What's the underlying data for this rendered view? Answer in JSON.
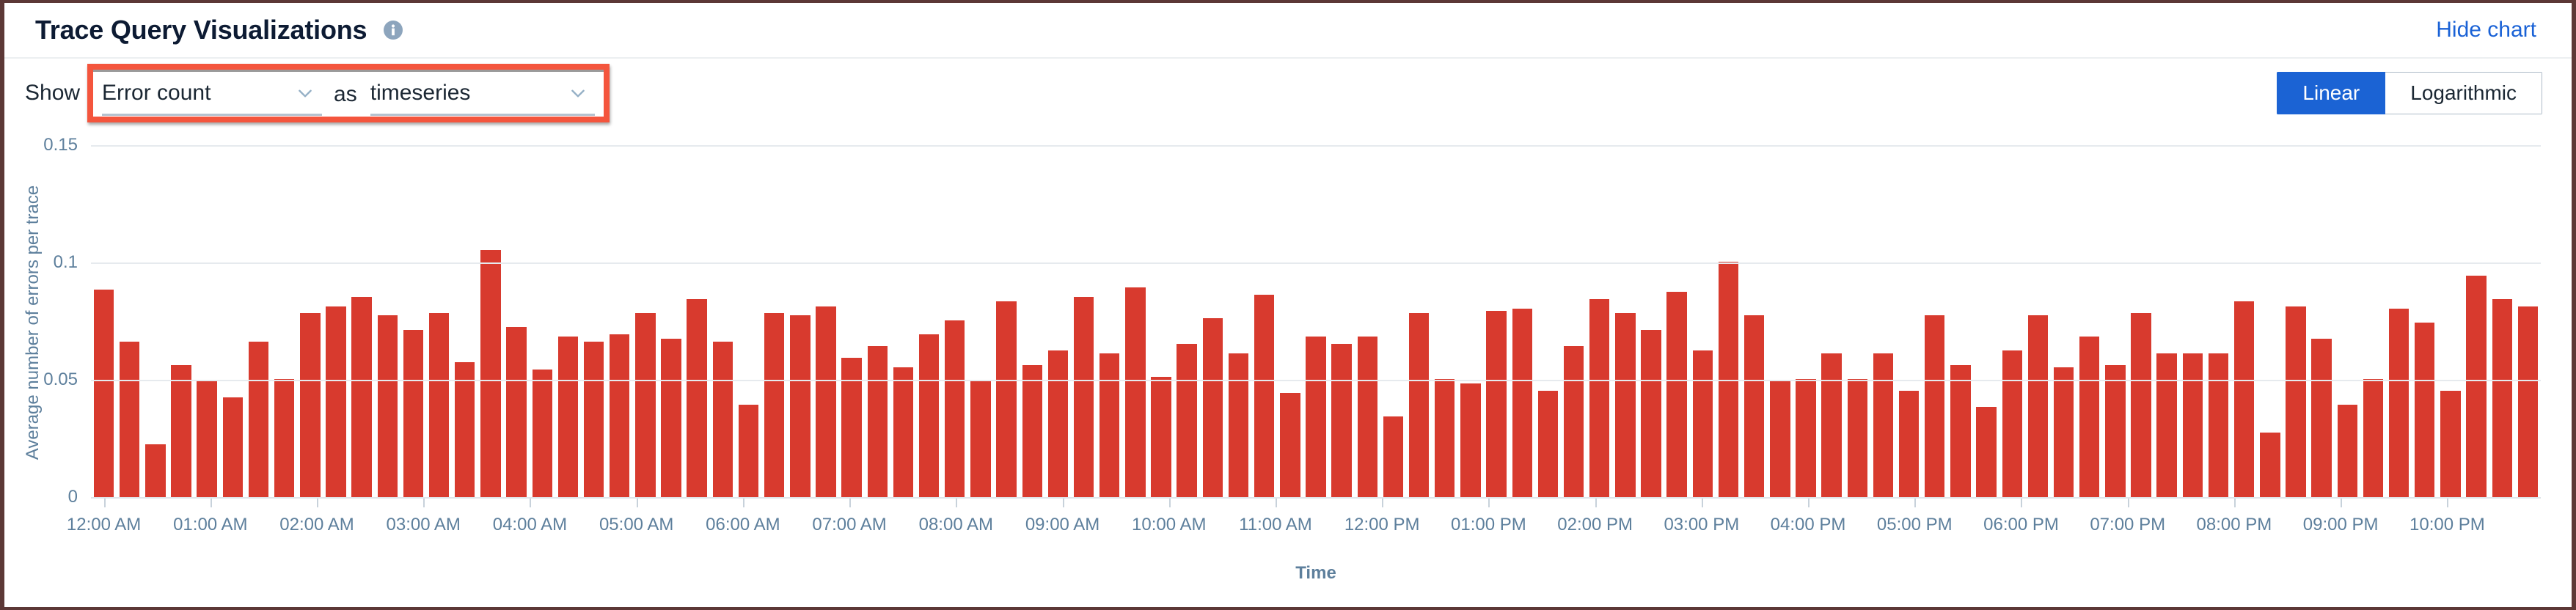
{
  "header": {
    "title": "Trace Query Visualizations",
    "info_icon": "info-icon",
    "hide_chart_label": "Hide chart"
  },
  "controls": {
    "show_label": "Show",
    "metric_select": {
      "value": "Error count",
      "chevron": "chevron-down-icon"
    },
    "as_label": "as",
    "viz_select": {
      "value": "timeseries",
      "chevron": "chevron-down-icon"
    },
    "scale_toggle": {
      "linear_label": "Linear",
      "logarithmic_label": "Logarithmic",
      "active": "Linear"
    },
    "highlight_color": "#f4553d"
  },
  "colors": {
    "bar": "#d83a2e",
    "accent_blue": "#1b63d4",
    "axis_text": "#5d7f9c",
    "gridline": "#e6eaee"
  },
  "chart_data": {
    "type": "bar",
    "title": "",
    "xlabel": "Time",
    "ylabel": "Average number of errors per trace",
    "ylim": [
      0,
      0.15
    ],
    "yticks": [
      "0",
      "0.05",
      "0.1",
      "0.15"
    ],
    "ytick_values": [
      0,
      0.05,
      0.1,
      0.15
    ],
    "grid": true,
    "legend": "none",
    "xtick_labels": [
      "12:00 AM",
      "01:00 AM",
      "02:00 AM",
      "03:00 AM",
      "04:00 AM",
      "05:00 AM",
      "06:00 AM",
      "07:00 AM",
      "08:00 AM",
      "09:00 AM",
      "10:00 AM",
      "11:00 AM",
      "12:00 PM",
      "01:00 PM",
      "02:00 PM",
      "03:00 PM",
      "04:00 PM",
      "05:00 PM",
      "06:00 PM",
      "07:00 PM",
      "08:00 PM",
      "09:00 PM",
      "10:00 PM"
    ],
    "values": [
      0.089,
      0.067,
      0.023,
      0.057,
      0.05,
      0.043,
      0.067,
      0.051,
      0.079,
      0.082,
      0.086,
      0.078,
      0.072,
      0.079,
      0.058,
      0.106,
      0.073,
      0.055,
      0.069,
      0.067,
      0.07,
      0.079,
      0.068,
      0.085,
      0.067,
      0.04,
      0.079,
      0.078,
      0.082,
      0.06,
      0.065,
      0.056,
      0.07,
      0.076,
      0.05,
      0.084,
      0.057,
      0.063,
      0.086,
      0.062,
      0.09,
      0.052,
      0.066,
      0.077,
      0.062,
      0.087,
      0.045,
      0.069,
      0.066,
      0.069,
      0.035,
      0.079,
      0.051,
      0.049,
      0.08,
      0.081,
      0.046,
      0.065,
      0.085,
      0.079,
      0.072,
      0.088,
      0.063,
      0.101,
      0.078,
      0.05,
      0.051,
      0.062,
      0.051,
      0.062,
      0.046,
      0.078,
      0.057,
      0.039,
      0.063,
      0.078,
      0.056,
      0.069,
      0.057,
      0.079,
      0.062,
      0.062,
      0.062,
      0.084,
      0.028,
      0.082,
      0.068,
      0.04,
      0.051,
      0.081,
      0.075,
      0.046,
      0.095,
      0.085,
      0.082
    ]
  }
}
